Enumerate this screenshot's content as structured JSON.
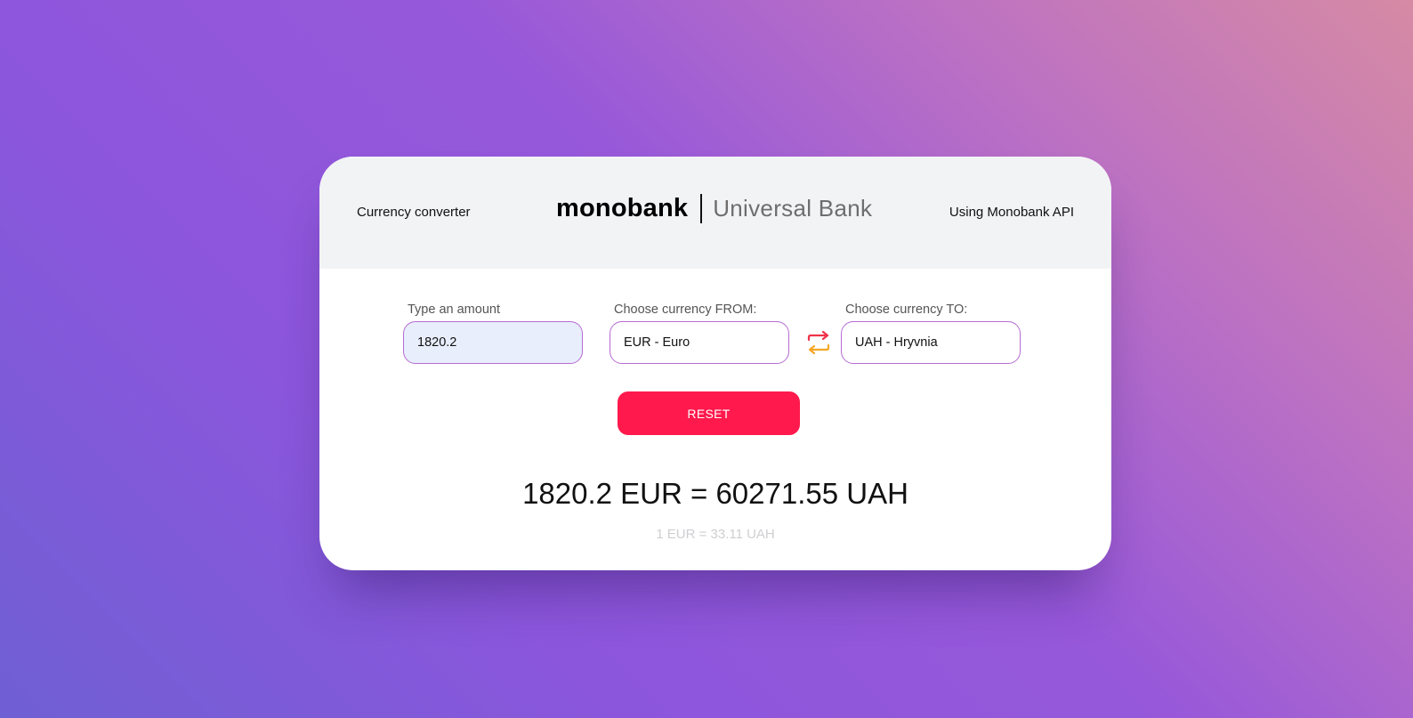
{
  "header": {
    "left_text": "Currency converter",
    "logo_brand": "monobank",
    "logo_tagline": "Universal Bank",
    "right_text": "Using Monobank API"
  },
  "form": {
    "amount_label": "Type an amount",
    "amount_value": "1820.2",
    "from_label": "Choose currency FROM:",
    "from_value": "EUR - Euro",
    "to_label": "Choose currency TO:",
    "to_value": "UAH - Hryvnia",
    "swap_icon": "swap-arrows-icon",
    "reset_label": "RESET"
  },
  "result": {
    "conversion_text": "1820.2 EUR = 60271.55 UAH",
    "rate_text": "1 EUR = 33.11 UAH"
  },
  "colors": {
    "accent_red": "#ff194c",
    "field_border": "#b66bd3",
    "amount_field_bg": "#e8eefc",
    "header_bg": "#f2f3f5",
    "swap_icon_red": "#f0334a",
    "swap_icon_orange": "#f5a623"
  }
}
